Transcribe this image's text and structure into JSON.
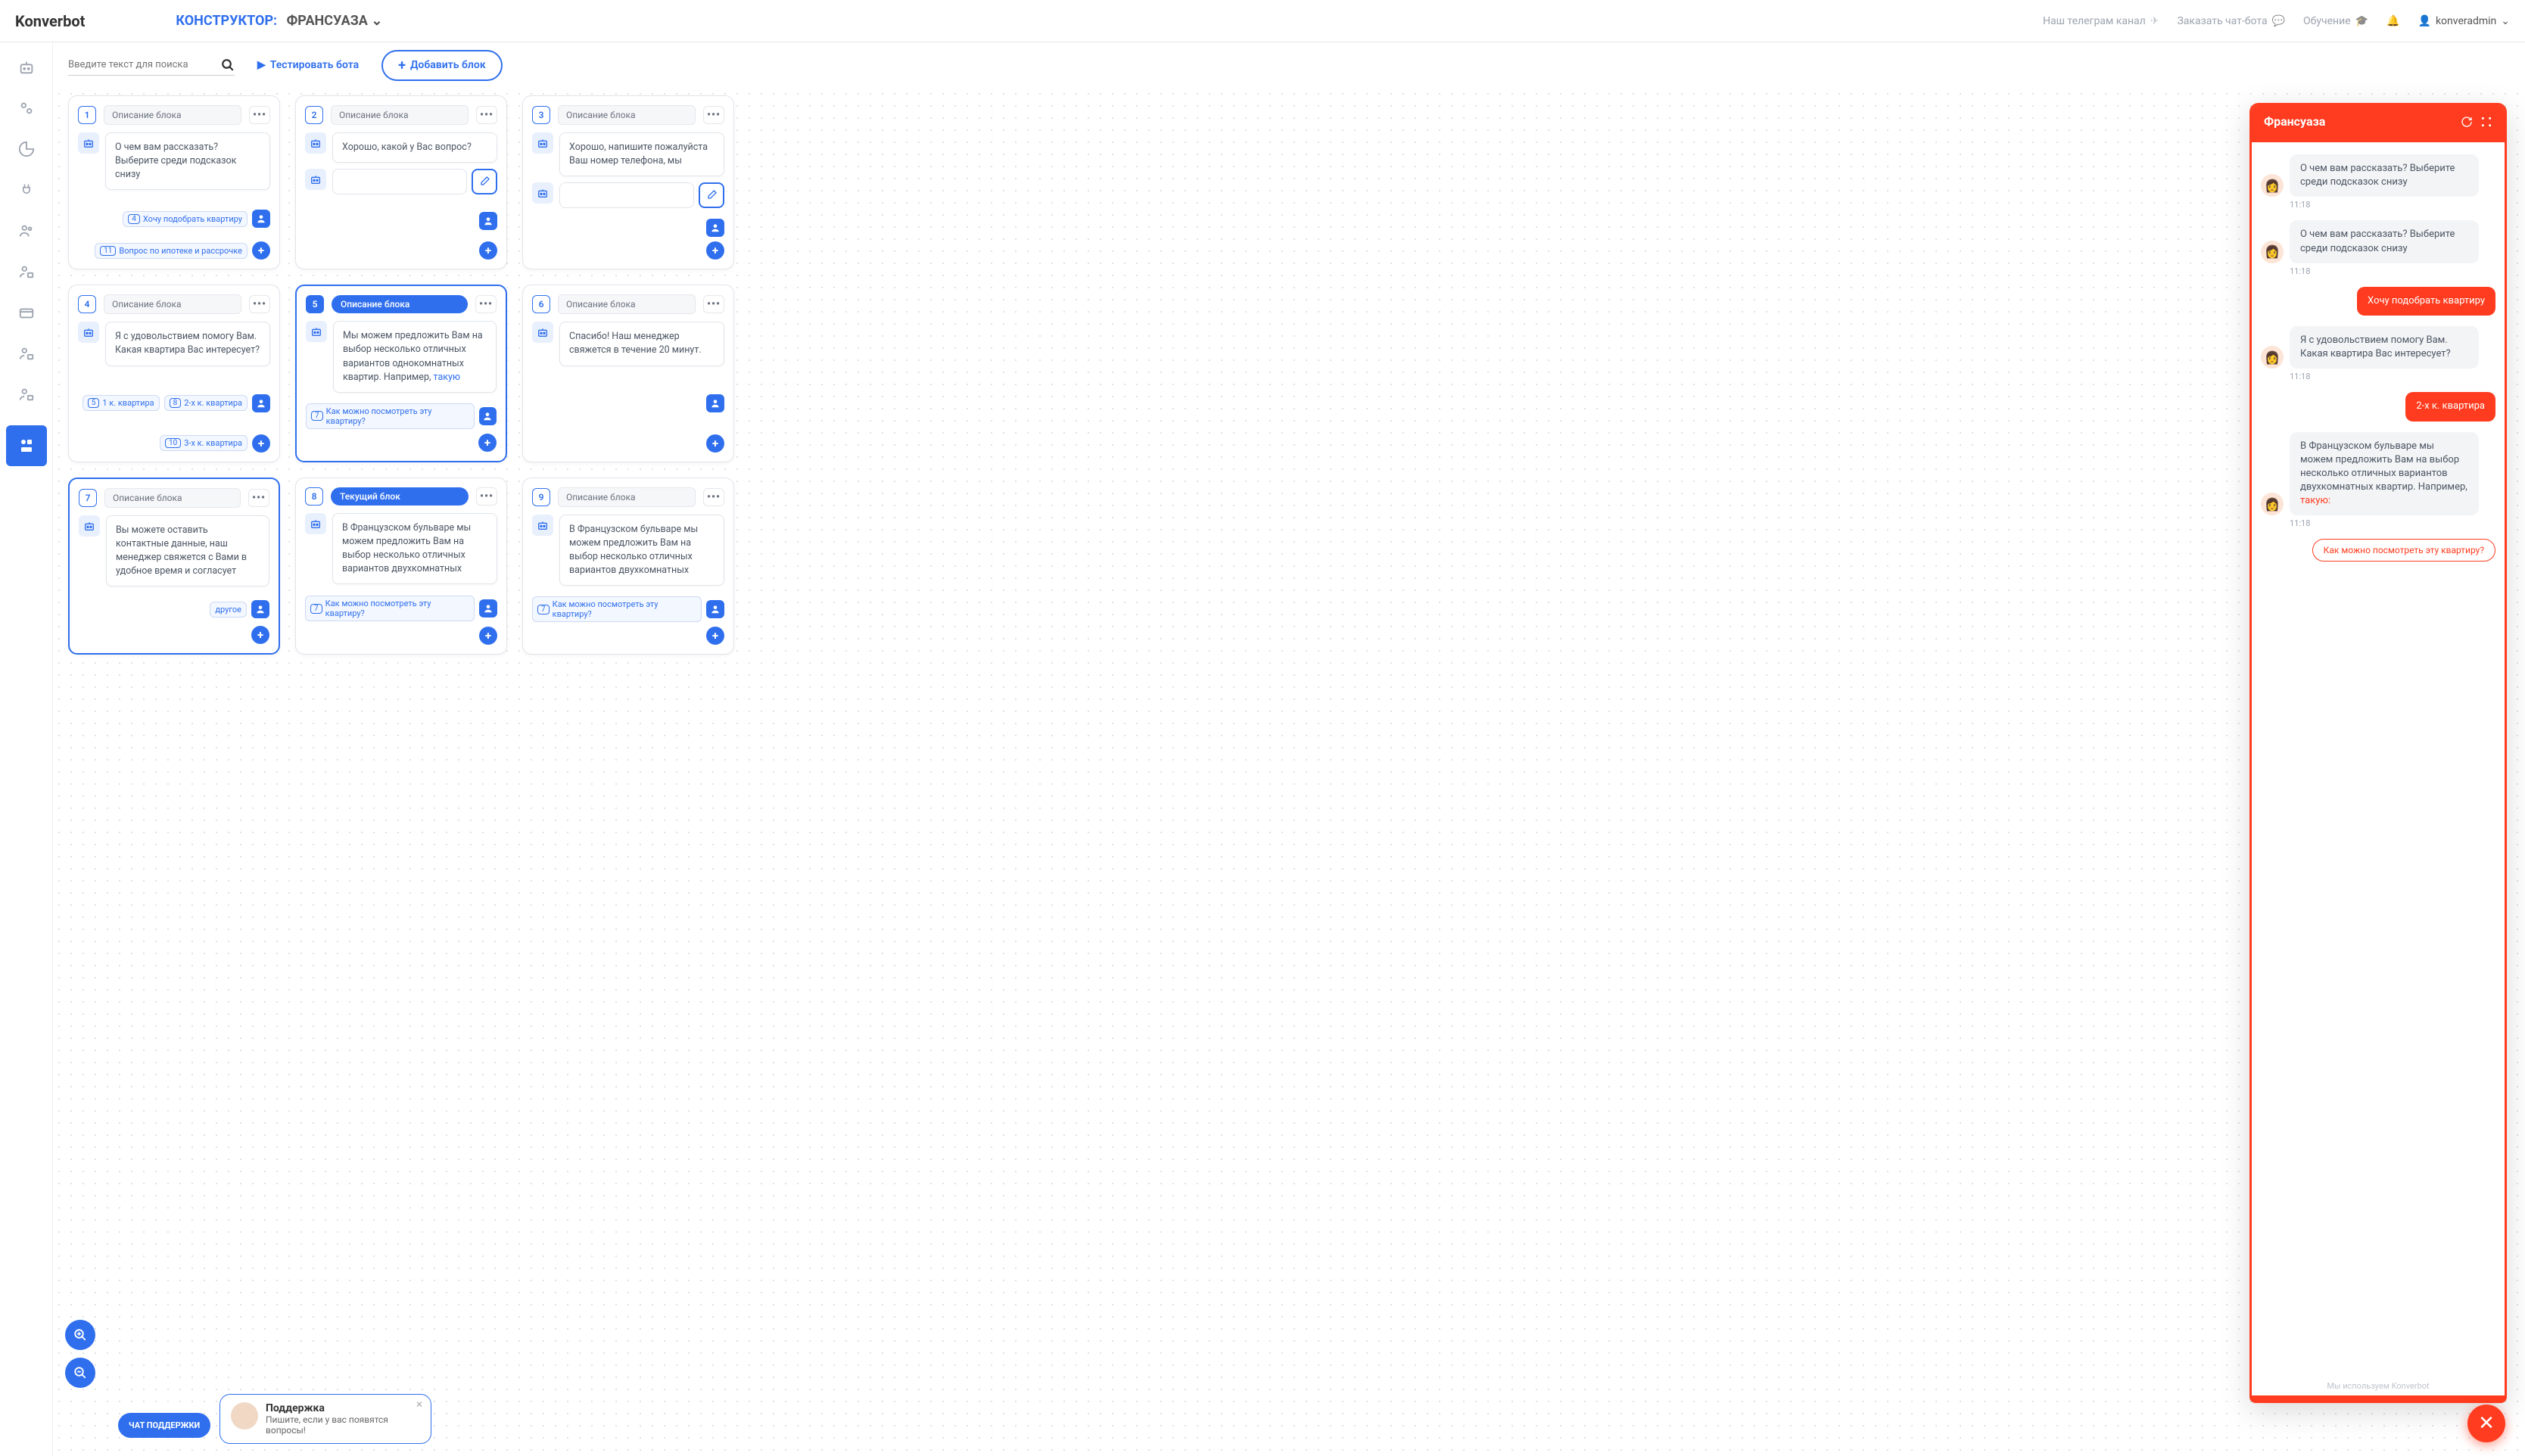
{
  "header": {
    "logo": "Konverbot",
    "breadcrumb_label": "КОНСТРУКТОР:",
    "bot_name": "ФРАНСУАЗА",
    "nav": {
      "telegram": "Наш телеграм канал",
      "order": "Заказать чат-бота",
      "learn": "Обучение"
    },
    "user": "konveradmin"
  },
  "toolbar": {
    "search_placeholder": "Введите текст для поиска",
    "test_label": "Тестировать бота",
    "add_label": "Добавить блок"
  },
  "blocks": [
    {
      "num": "1",
      "desc": "Описание блока",
      "msgs": [
        "О чем вам рассказать? Выберите среди подсказок снизу"
      ],
      "replies": [
        {
          "n": "4",
          "t": "Хочу подобрать квартиру"
        },
        {
          "n": "11",
          "t": "Вопрос по ипотеке и рассрочке"
        }
      ]
    },
    {
      "num": "2",
      "desc": "Описание блока",
      "msgs": [
        "Хорошо, какой у Вас вопрос?"
      ],
      "input": true,
      "replies": []
    },
    {
      "num": "3",
      "desc": "Описание блока",
      "msgs": [
        "Хорошо, напишите пожалуйста Ваш номер телефона, мы"
      ],
      "input": true,
      "replies": []
    },
    {
      "num": "4",
      "desc": "Описание блока",
      "msgs": [
        "Я с удовольствием помогу Вам. Какая квартира Вас интересует?"
      ],
      "replies": [
        {
          "n": "5",
          "t": "1 к. квартира"
        },
        {
          "n": "8",
          "t": "2-х к. квартира"
        },
        {
          "n": "10",
          "t": "3-х к. квартира"
        }
      ]
    },
    {
      "num": "5",
      "desc": "Описание блока",
      "active": true,
      "msgs": [
        "Мы можем предложить Вам на выбор несколько отличных вариантов однокомнатных квартир. Например, <a>такую</a>"
      ],
      "replies": [
        {
          "n": "7",
          "t": "Как можно посмотреть эту квартиру?"
        }
      ]
    },
    {
      "num": "6",
      "desc": "Описание блока",
      "msgs": [
        "Спасибо! Наш менеджер свяжется в течение 20 минут."
      ],
      "replies": []
    },
    {
      "num": "7",
      "desc": "Описание блока",
      "sel": true,
      "msgs": [
        "Вы можете оставить контактные данные, наш менеджер свяжется с Вами в удобное время и согласует"
      ],
      "replies": [
        {
          "n": "",
          "t": "другое"
        }
      ]
    },
    {
      "num": "8",
      "desc": "Текущий блок",
      "current": true,
      "msgs": [
        "В Французском бульваре мы можем предложить Вам на выбор несколько отличных вариантов двухкомнатных"
      ],
      "replies": [
        {
          "n": "7",
          "t": "Как можно посмотреть эту квартиру?"
        }
      ]
    },
    {
      "num": "9",
      "desc": "Описание блока",
      "msgs": [
        "В Французском бульваре мы можем предложить Вам на выбор несколько отличных вариантов двухкомнатных"
      ],
      "replies": [
        {
          "n": "7",
          "t": "Как можно посмотреть эту квартиру?"
        }
      ]
    }
  ],
  "support": {
    "pill": "ЧАТ ПОДДЕРЖКИ",
    "title": "Поддержка",
    "sub": "Пишите, если у вас появятся вопросы!"
  },
  "preview": {
    "title": "Франсуаза",
    "messages": [
      {
        "type": "bot",
        "text": "О чем вам рассказать? Выберите среди подсказок снизу",
        "time": "11:18"
      },
      {
        "type": "bot",
        "text": "О чем вам рассказать? Выберите среди подсказок снизу",
        "time": "11:18"
      },
      {
        "type": "user",
        "text": "Хочу подобрать квартиру"
      },
      {
        "type": "bot",
        "text": "Я с удовольствием помогу Вам. Какая квартира Вас интересует?",
        "time": "11:18"
      },
      {
        "type": "user",
        "text": "2-х к. квартира"
      },
      {
        "type": "bot",
        "text": "В Французском бульваре мы можем предложить Вам на выбор несколько отличных вариантов двухкомнатных квартир. Например, <a>такую:</a>",
        "time": "11:18"
      }
    ],
    "suggest": "Как можно посмотреть эту квартиру?",
    "footer": "Мы используем Konverbot"
  }
}
